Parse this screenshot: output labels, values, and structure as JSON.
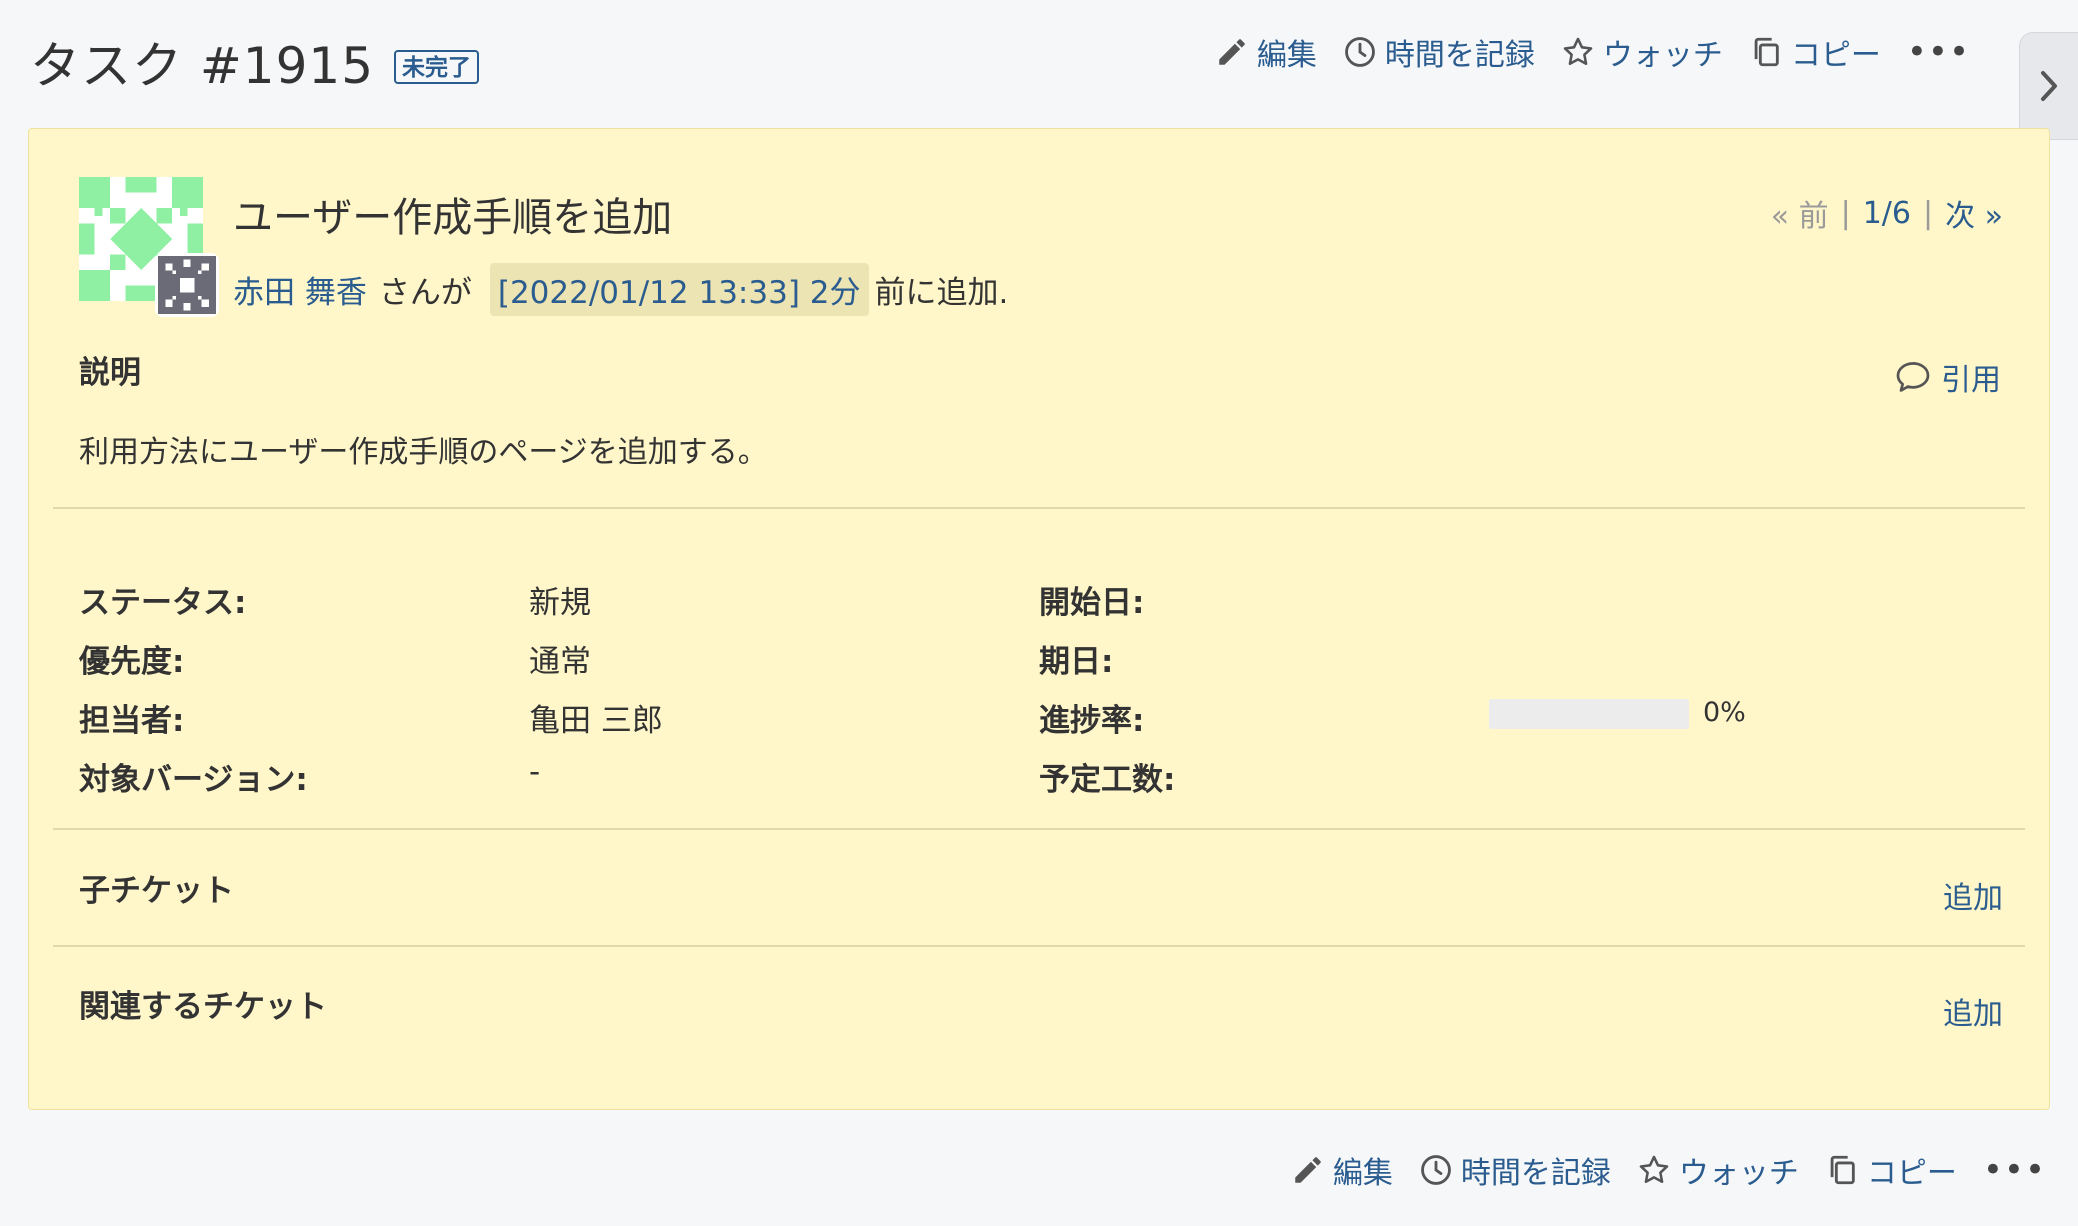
{
  "header": {
    "title": "タスク #1915",
    "status_badge": "未完了"
  },
  "actions": {
    "edit": "編集",
    "log_time": "時間を記録",
    "watch": "ウォッチ",
    "copy": "コピー",
    "more": "•••"
  },
  "issue": {
    "subject": "ユーザー作成手順を追加",
    "author": "赤田 舞香",
    "author_suffix": "さんが",
    "timestamp": "[2022/01/12 13:33] 2分",
    "added_suffix": "前に追加.",
    "pager": {
      "prev": "« 前",
      "sep1": "|",
      "position": "1/6",
      "sep2": "|",
      "next": "次 »"
    },
    "description_title": "説明",
    "quote": "引用",
    "description": "利用方法にユーザー作成手順のページを追加する。",
    "attributes": {
      "status_label": "ステータス:",
      "status_value": "新規",
      "priority_label": "優先度:",
      "priority_value": "通常",
      "assignee_label": "担当者:",
      "assignee_value": "亀田 三郎",
      "version_label": "対象バージョン:",
      "version_value": "-",
      "start_label": "開始日:",
      "due_label": "期日:",
      "progress_label": "進捗率:",
      "progress_text": "0%",
      "progress_value": 0,
      "estimate_label": "予定工数:"
    },
    "subtasks_title": "子チケット",
    "subtasks_add": "追加",
    "related_title": "関連するチケット",
    "related_add": "追加"
  },
  "colors": {
    "link": "#2a5c8f",
    "panel_bg": "#fff7c9",
    "avatar_green": "#8ff0a4"
  }
}
